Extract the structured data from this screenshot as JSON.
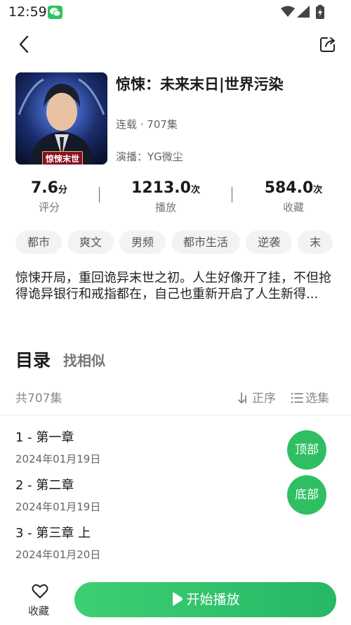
{
  "status_bar": {
    "time": "12:59"
  },
  "drama": {
    "title": "惊悚：未来末日|世界污染",
    "cover_badge": "惊悚末世",
    "meta": "连载 · 707集",
    "cast": "演播：YG微尘"
  },
  "stats": [
    {
      "value": "7.6",
      "unit": "分",
      "label": "评分"
    },
    {
      "value": "1213.0",
      "unit": "次",
      "label": "播放"
    },
    {
      "value": "584.0",
      "unit": "次",
      "label": "收藏"
    }
  ],
  "tags": [
    "都市",
    "爽文",
    "男频",
    "都市生活",
    "逆袭",
    "末"
  ],
  "description": "惊悚开局，重回诡异末世之初。人生好像开了挂，不但抢得诡异银行和戒指都在，自己也重新开启了人生新得...",
  "catalog": {
    "title": "目录",
    "similar_label": "找相似",
    "episode_count": "共707集",
    "sort_label": "正序",
    "select_label": "选集"
  },
  "episodes": [
    {
      "title": "1 - 第一章",
      "date": "2024年01月19日"
    },
    {
      "title": "2 - 第二章",
      "date": "2024年01月19日"
    },
    {
      "title": "3 - 第三章 上",
      "date": "2024年01月20日"
    }
  ],
  "fab": {
    "top_label": "顶部",
    "bottom_label": "底部"
  },
  "bottom_bar": {
    "favorite_label": "收藏",
    "play_label": "开始播放"
  },
  "colors": {
    "accent": "#2fbf62",
    "play_gradient_start": "#3ecf73",
    "play_gradient_end": "#27b766"
  },
  "icons": [
    "back-icon",
    "share-icon",
    "sort-icon",
    "list-icon",
    "heart-icon",
    "play-icon",
    "wifi-icon",
    "signal-icon",
    "battery-icon",
    "wechat-icon"
  ]
}
